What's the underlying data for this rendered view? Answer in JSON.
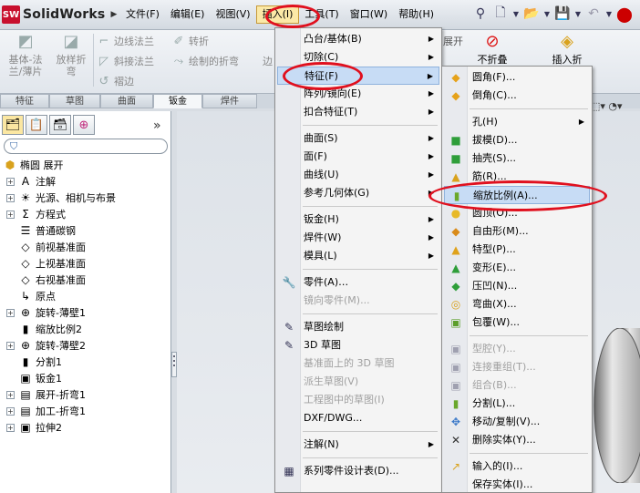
{
  "app": {
    "name": "SolidWorks",
    "logo_badge": "SW"
  },
  "menubar": [
    "文件(F)",
    "编辑(E)",
    "视图(V)",
    "插入(I)",
    "工具(T)",
    "窗口(W)",
    "帮助(H)"
  ],
  "ribbon": {
    "base_flange": "基体-法\n兰/薄片",
    "lofted_bend": "放样折\n弯",
    "edge_flange": "边线法兰",
    "miter_flange": "斜接法兰",
    "hem": "褶边",
    "sketched_bend_top": "转折",
    "sketched_bend": "绘制的折弯",
    "cut_off": "不折叠",
    "insert_bends": "插入折",
    "partial_left": "边",
    "partial_mid": "展开"
  },
  "tabs": [
    "特征",
    "草图",
    "曲面",
    "钣金",
    "焊件"
  ],
  "feature_tree": {
    "root": "椭圆  展开",
    "items": [
      {
        "label": "注解",
        "exp": true,
        "icon": "A"
      },
      {
        "label": "光源、相机与布景",
        "exp": true,
        "icon": "☀"
      },
      {
        "label": "方程式",
        "exp": true,
        "icon": "Σ"
      },
      {
        "label": "普通碳钢",
        "exp": false,
        "icon": "☰"
      },
      {
        "label": "前视基准面",
        "exp": false,
        "icon": "◇"
      },
      {
        "label": "上视基准面",
        "exp": false,
        "icon": "◇"
      },
      {
        "label": "右视基准面",
        "exp": false,
        "icon": "◇"
      },
      {
        "label": "原点",
        "exp": false,
        "icon": "↳"
      },
      {
        "label": "旋转-薄壁1",
        "exp": true,
        "icon": "⊕"
      },
      {
        "label": "缩放比例2",
        "exp": false,
        "icon": "▮"
      },
      {
        "label": "旋转-薄壁2",
        "exp": true,
        "icon": "⊕"
      },
      {
        "label": "分割1",
        "exp": false,
        "icon": "▮"
      },
      {
        "label": "钣金1",
        "exp": false,
        "icon": "▣"
      },
      {
        "label": "展开-折弯1",
        "exp": true,
        "icon": "▤"
      },
      {
        "label": "加工-折弯1",
        "exp": true,
        "icon": "▤"
      },
      {
        "label": "拉伸2",
        "exp": true,
        "icon": "▣"
      }
    ]
  },
  "insert_menu": [
    {
      "label": "凸台/基体(B)",
      "sub": true
    },
    {
      "label": "切除(C)",
      "sub": true
    },
    {
      "label": "特征(F)",
      "sub": true,
      "hl": true
    },
    {
      "label": "阵列/镜向(E)",
      "sub": true
    },
    {
      "label": "扣合特征(T)",
      "sub": true
    },
    {
      "sep": true
    },
    {
      "label": "曲面(S)",
      "sub": true
    },
    {
      "label": "面(F)",
      "sub": true
    },
    {
      "label": "曲线(U)",
      "sub": true
    },
    {
      "label": "参考几何体(G)",
      "sub": true
    },
    {
      "sep": true
    },
    {
      "label": "钣金(H)",
      "sub": true
    },
    {
      "label": "焊件(W)",
      "sub": true
    },
    {
      "label": "模具(L)",
      "sub": true
    },
    {
      "sep": true
    },
    {
      "label": "零件(A)…",
      "icon": "🔧"
    },
    {
      "label": "镜向零件(M)...",
      "disabled": true
    },
    {
      "sep": true
    },
    {
      "label": "草图绘制",
      "icon": "✎"
    },
    {
      "label": "3D 草图",
      "icon": "✎"
    },
    {
      "label": "基准面上的 3D 草图",
      "disabled": true
    },
    {
      "label": "派生草图(V)",
      "disabled": true
    },
    {
      "label": "工程图中的草图(I)",
      "disabled": true
    },
    {
      "label": "DXF/DWG..."
    },
    {
      "sep": true
    },
    {
      "label": "注解(N)",
      "sub": true
    },
    {
      "sep": true
    },
    {
      "label": "系列零件设计表(D)...",
      "icon": "▦"
    }
  ],
  "feature_menu": [
    {
      "label": "圆角(F)...",
      "icon": "◆",
      "color": "#e6a21a"
    },
    {
      "label": "倒角(C)...",
      "icon": "◆",
      "color": "#e6a21a"
    },
    {
      "sep": true
    },
    {
      "label": "孔(H)",
      "sub": true
    },
    {
      "label": "拔模(D)...",
      "icon": "■",
      "color": "#2e9e3a"
    },
    {
      "label": "抽壳(S)...",
      "icon": "■",
      "color": "#2e9e3a"
    },
    {
      "label": "筋(R)...",
      "icon": "▲",
      "color": "#d9a21d"
    },
    {
      "label": "缩放比例(A)...",
      "icon": "▮",
      "color": "#6aa82b",
      "hl": true
    },
    {
      "label": "圆顶(O)...",
      "icon": "●",
      "color": "#e7b928"
    },
    {
      "label": "自由形(M)...",
      "icon": "◆",
      "color": "#d98b1a"
    },
    {
      "label": "特型(P)...",
      "icon": "▲",
      "color": "#dfa21c"
    },
    {
      "label": "变形(E)...",
      "icon": "▲",
      "color": "#2e9e3a"
    },
    {
      "label": "压凹(N)...",
      "icon": "◆",
      "color": "#2e9e3a"
    },
    {
      "label": "弯曲(X)...",
      "icon": "◎",
      "color": "#d9a21d"
    },
    {
      "label": "包覆(W)...",
      "icon": "▣",
      "color": "#5b9e2a"
    },
    {
      "sep": true
    },
    {
      "label": "型腔(Y)...",
      "disabled": true,
      "icon": "▣"
    },
    {
      "label": "连接重组(T)...",
      "disabled": true,
      "icon": "▣"
    },
    {
      "label": "组合(B)...",
      "disabled": true,
      "icon": "▣"
    },
    {
      "label": "分割(L)...",
      "icon": "▮",
      "color": "#6aa82b"
    },
    {
      "label": "移动/复制(V)...",
      "icon": "✥",
      "color": "#3a78c8"
    },
    {
      "label": "删除实体(Y)...",
      "icon": "✕",
      "color": "#333"
    },
    {
      "sep": true
    },
    {
      "label": "输入的(I)...",
      "icon": "↗",
      "color": "#d9a21d"
    },
    {
      "label": "保存实体(I)...",
      "icon": ""
    }
  ],
  "colors": {
    "highlight": "#c7dcf5",
    "annotation": "#e0101e",
    "active_menu": "#fbe9a7"
  }
}
